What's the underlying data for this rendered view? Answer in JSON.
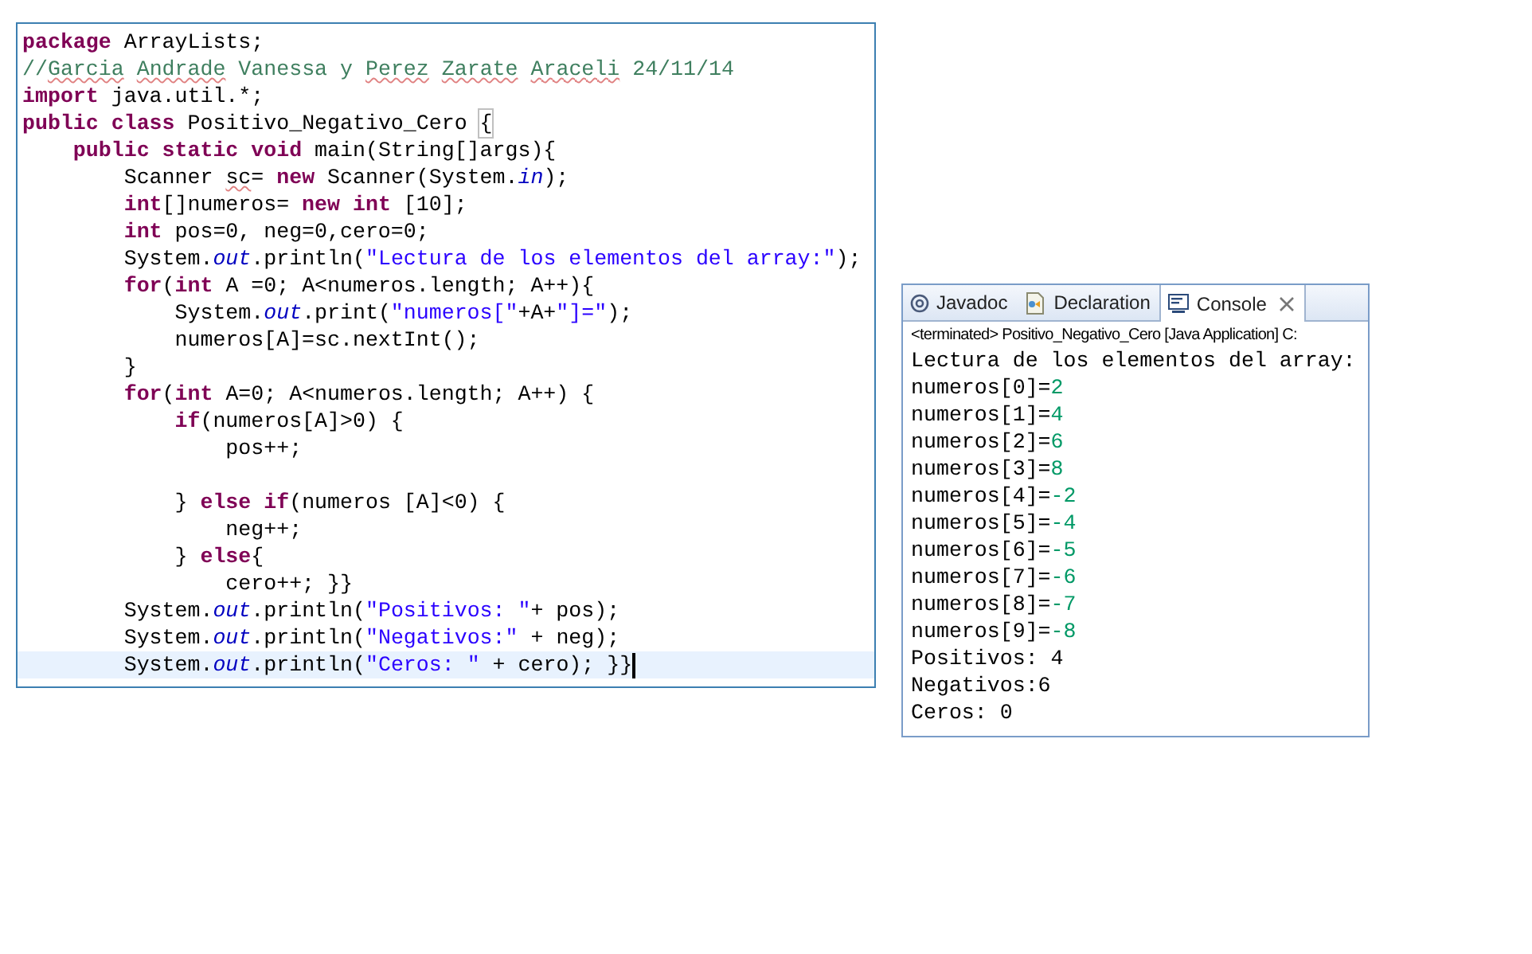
{
  "editor": {
    "lines": [
      {
        "tokens": [
          {
            "kind": "keyword",
            "text": "package"
          },
          {
            "kind": "text",
            "text": " ArrayLists;"
          }
        ]
      },
      {
        "tokens": [
          {
            "kind": "comment",
            "text": "//"
          },
          {
            "kind": "comment",
            "text": "Garcia",
            "misspelled": true
          },
          {
            "kind": "comment",
            "text": " Andrade",
            "misspelled": true
          },
          {
            "kind": "comment",
            "text": " Vanessa y"
          },
          {
            "kind": "comment",
            "text": " Perez",
            "misspelled": true
          },
          {
            "kind": "comment",
            "text": " Zarate",
            "misspelled": true
          },
          {
            "kind": "comment",
            "text": " Araceli",
            "misspelled": true
          },
          {
            "kind": "comment",
            "text": " 24/11/14"
          }
        ]
      },
      {
        "tokens": [
          {
            "kind": "keyword",
            "text": "import"
          },
          {
            "kind": "text",
            "text": " java.util.*;"
          }
        ]
      },
      {
        "tokens": [
          {
            "kind": "keyword",
            "text": "public"
          },
          {
            "kind": "keyword",
            "text": " class"
          },
          {
            "kind": "text",
            "text": " Positivo_Negativo_Cero"
          },
          {
            "kind": "text",
            "text": " {",
            "matched": true
          }
        ]
      },
      {
        "tokens": [
          {
            "kind": "keyword",
            "text": "    public"
          },
          {
            "kind": "keyword",
            "text": " static"
          },
          {
            "kind": "keyword",
            "text": " void"
          },
          {
            "kind": "text",
            "text": " main(String[]args){"
          }
        ]
      },
      {
        "tokens": [
          {
            "kind": "text",
            "text": "        Scanner"
          },
          {
            "kind": "text",
            "text": " sc",
            "misspelled": true
          },
          {
            "kind": "text",
            "text": "="
          },
          {
            "kind": "keyword",
            "text": " new"
          },
          {
            "kind": "text",
            "text": " Scanner(System."
          },
          {
            "kind": "static",
            "text": "in"
          },
          {
            "kind": "text",
            "text": ");"
          }
        ]
      },
      {
        "tokens": [
          {
            "kind": "keyword",
            "text": "        int"
          },
          {
            "kind": "text",
            "text": "[]numeros="
          },
          {
            "kind": "keyword",
            "text": " new"
          },
          {
            "kind": "keyword",
            "text": " int"
          },
          {
            "kind": "text",
            "text": " [10];"
          }
        ]
      },
      {
        "tokens": [
          {
            "kind": "keyword",
            "text": "        int"
          },
          {
            "kind": "text",
            "text": " pos=0, neg=0,cero=0;"
          }
        ]
      },
      {
        "tokens": [
          {
            "kind": "text",
            "text": "        System."
          },
          {
            "kind": "static",
            "text": "out"
          },
          {
            "kind": "text",
            "text": ".println("
          },
          {
            "kind": "string",
            "text": "\"Lectura de los elementos del array:\""
          },
          {
            "kind": "text",
            "text": ");"
          }
        ]
      },
      {
        "tokens": [
          {
            "kind": "keyword",
            "text": "        for"
          },
          {
            "kind": "text",
            "text": "("
          },
          {
            "kind": "keyword",
            "text": "int"
          },
          {
            "kind": "text",
            "text": " A =0; A<numeros.length; A++){"
          }
        ]
      },
      {
        "tokens": [
          {
            "kind": "text",
            "text": "            System."
          },
          {
            "kind": "static",
            "text": "out"
          },
          {
            "kind": "text",
            "text": ".print("
          },
          {
            "kind": "string",
            "text": "\"numeros[\""
          },
          {
            "kind": "text",
            "text": "+A+"
          },
          {
            "kind": "string",
            "text": "\"]=\""
          },
          {
            "kind": "text",
            "text": ");"
          }
        ]
      },
      {
        "tokens": [
          {
            "kind": "text",
            "text": "            numeros[A]=sc.nextInt();"
          }
        ]
      },
      {
        "tokens": [
          {
            "kind": "text",
            "text": "        }"
          }
        ]
      },
      {
        "tokens": [
          {
            "kind": "keyword",
            "text": "        for"
          },
          {
            "kind": "text",
            "text": "("
          },
          {
            "kind": "keyword",
            "text": "int"
          },
          {
            "kind": "text",
            "text": " A=0; A<numeros.length; A++) {"
          }
        ]
      },
      {
        "tokens": [
          {
            "kind": "keyword",
            "text": "            if"
          },
          {
            "kind": "text",
            "text": "(numeros[A]>0) {"
          }
        ]
      },
      {
        "tokens": [
          {
            "kind": "text",
            "text": "                pos++;"
          }
        ]
      },
      {
        "blank_line_before": true,
        "tokens": [
          {
            "kind": "text",
            "text": "            }"
          },
          {
            "kind": "keyword",
            "text": " else"
          },
          {
            "kind": "keyword",
            "text": " if"
          },
          {
            "kind": "text",
            "text": "(numeros [A]<0) {"
          }
        ]
      },
      {
        "tokens": [
          {
            "kind": "text",
            "text": "                neg++;"
          }
        ]
      },
      {
        "tokens": [
          {
            "kind": "text",
            "text": "            }"
          },
          {
            "kind": "keyword",
            "text": " else"
          },
          {
            "kind": "text",
            "text": "{"
          }
        ]
      },
      {
        "tokens": [
          {
            "kind": "text",
            "text": "                cero++; }}"
          }
        ]
      },
      {
        "tokens": [
          {
            "kind": "text",
            "text": "        System."
          },
          {
            "kind": "static",
            "text": "out"
          },
          {
            "kind": "text",
            "text": ".println("
          },
          {
            "kind": "string",
            "text": "\"Positivos: \""
          },
          {
            "kind": "text",
            "text": "+ pos);"
          }
        ]
      },
      {
        "tokens": [
          {
            "kind": "text",
            "text": "        System."
          },
          {
            "kind": "static",
            "text": "out"
          },
          {
            "kind": "text",
            "text": ".println("
          },
          {
            "kind": "string",
            "text": "\"Negativos:\""
          },
          {
            "kind": "text",
            "text": " + neg);"
          }
        ]
      },
      {
        "current": true,
        "tokens": [
          {
            "kind": "text",
            "text": "        System."
          },
          {
            "kind": "static",
            "text": "out"
          },
          {
            "kind": "text",
            "text": ".println("
          },
          {
            "kind": "string",
            "text": "\"Ceros: \""
          },
          {
            "kind": "text",
            "text": " + cero); }}"
          }
        ]
      }
    ]
  },
  "console_view": {
    "tabs": [
      {
        "label": "Javadoc",
        "selected": false,
        "closable": false
      },
      {
        "label": "Declaration",
        "selected": false,
        "closable": false
      },
      {
        "label": "Console",
        "selected": true,
        "closable": true
      }
    ],
    "status": "<terminated> Positivo_Negativo_Cero [Java Application] C:",
    "lines": [
      {
        "tokens": [
          {
            "kind": "output",
            "text": "Lectura de los elementos del array:"
          }
        ]
      },
      {
        "tokens": [
          {
            "kind": "output",
            "text": "numeros[0]="
          },
          {
            "kind": "input",
            "text": "2"
          }
        ]
      },
      {
        "tokens": [
          {
            "kind": "output",
            "text": "numeros[1]="
          },
          {
            "kind": "input",
            "text": "4"
          }
        ]
      },
      {
        "tokens": [
          {
            "kind": "output",
            "text": "numeros[2]="
          },
          {
            "kind": "input",
            "text": "6"
          }
        ]
      },
      {
        "tokens": [
          {
            "kind": "output",
            "text": "numeros[3]="
          },
          {
            "kind": "input",
            "text": "8"
          }
        ]
      },
      {
        "tokens": [
          {
            "kind": "output",
            "text": "numeros[4]="
          },
          {
            "kind": "input",
            "text": "-2"
          }
        ]
      },
      {
        "tokens": [
          {
            "kind": "output",
            "text": "numeros[5]="
          },
          {
            "kind": "input",
            "text": "-4"
          }
        ]
      },
      {
        "tokens": [
          {
            "kind": "output",
            "text": "numeros[6]="
          },
          {
            "kind": "input",
            "text": "-5"
          }
        ]
      },
      {
        "tokens": [
          {
            "kind": "output",
            "text": "numeros[7]="
          },
          {
            "kind": "input",
            "text": "-6"
          }
        ]
      },
      {
        "tokens": [
          {
            "kind": "output",
            "text": "numeros[8]="
          },
          {
            "kind": "input",
            "text": "-7"
          }
        ]
      },
      {
        "tokens": [
          {
            "kind": "output",
            "text": "numeros[9]="
          },
          {
            "kind": "input",
            "text": "-8"
          }
        ]
      },
      {
        "tokens": [
          {
            "kind": "output",
            "text": "Positivos: 4"
          }
        ]
      },
      {
        "tokens": [
          {
            "kind": "output",
            "text": "Negativos:6"
          }
        ]
      },
      {
        "tokens": [
          {
            "kind": "output",
            "text": "Ceros: 0"
          }
        ]
      }
    ]
  }
}
